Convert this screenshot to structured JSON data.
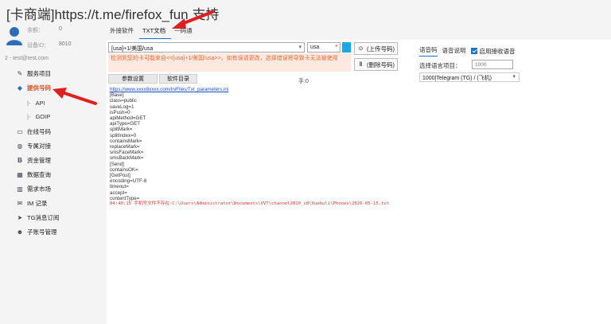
{
  "title": "[卡商端]https://t.me/firefox_fun 支持",
  "account": {
    "balance_label": "余额：",
    "balance_value": "0",
    "device_label": "设备ID：",
    "device_value": "8010",
    "user": "2 - test@test.com"
  },
  "sidebar": {
    "items": [
      {
        "label": "服务项目",
        "icon": "pen-icon"
      },
      {
        "label": "提供号码",
        "icon": "diamond-icon"
      },
      {
        "label": "在线号码",
        "icon": "monitor-icon"
      },
      {
        "label": "专属对接",
        "icon": "globe-icon"
      },
      {
        "label": "资金管理",
        "icon": "bitcoin-icon"
      },
      {
        "label": "数据查询",
        "icon": "table-icon"
      },
      {
        "label": "需求市场",
        "icon": "chart-icon"
      },
      {
        "label": "IM 记录",
        "icon": "chat-icon"
      },
      {
        "label": "TG消息订阅",
        "icon": "telegram-icon"
      },
      {
        "label": "子账号管理",
        "icon": "users-icon"
      }
    ],
    "subitems": [
      {
        "bar": "|-",
        "label": "API"
      },
      {
        "bar": "|-",
        "label": "GOIP"
      }
    ]
  },
  "tabs": [
    "外接软件",
    "TXT文档",
    "一码通"
  ],
  "main": {
    "country_value": "[usa]+1/美国/usa",
    "code_value": "usa",
    "warning": "检测到您的卡可能来自<<[usa]+1/美国/usa>>，如有误请更改，选择错误将导致卡无法被使用",
    "upload_btn": "(上传号码)",
    "delete_btn": "(删除号码)",
    "param_btn": "参数设置",
    "software_btn": "软件目录",
    "count_text": "手:0",
    "link": "https://www.xxxx8xxxx.com/IniFiles/Txt_parameters.ini",
    "config_lines": [
      "[Base]",
      "class=public",
      "saveLog=1",
      "isPush=0",
      "apiMethod=GET",
      "apiType=GET",
      "splitMark=",
      "splitIndex=0",
      "containsMark=",
      "replaceMark=",
      "smsFaceMark=",
      "smsBackMark=",
      "[Send]",
      "containsOK=",
      "[GetPost]",
      "encoding=UTF-8",
      "timeout=",
      "accept=",
      "contentType="
    ],
    "error_line": "04:40:15 手机号文件不存在:C:\\Users\\Administrator\\Documents\\VVT\\channel2020_v8\\Xuehuli\\Phones\\2026-05-15.txt"
  },
  "right": {
    "tabs": [
      "语音码",
      "语音说明"
    ],
    "enable_label": "启用接收语音",
    "select_label": "选择语言项目：",
    "amount_value": "1000",
    "project_value": "1000|Telegram (TG) / (飞机)"
  },
  "colors": {
    "accent": "#1a73c8",
    "warning_text": "#f06a35",
    "warning_bg": "#fde9df",
    "active_nav": "#e0501f",
    "annotation_arrow": "#e02020"
  }
}
